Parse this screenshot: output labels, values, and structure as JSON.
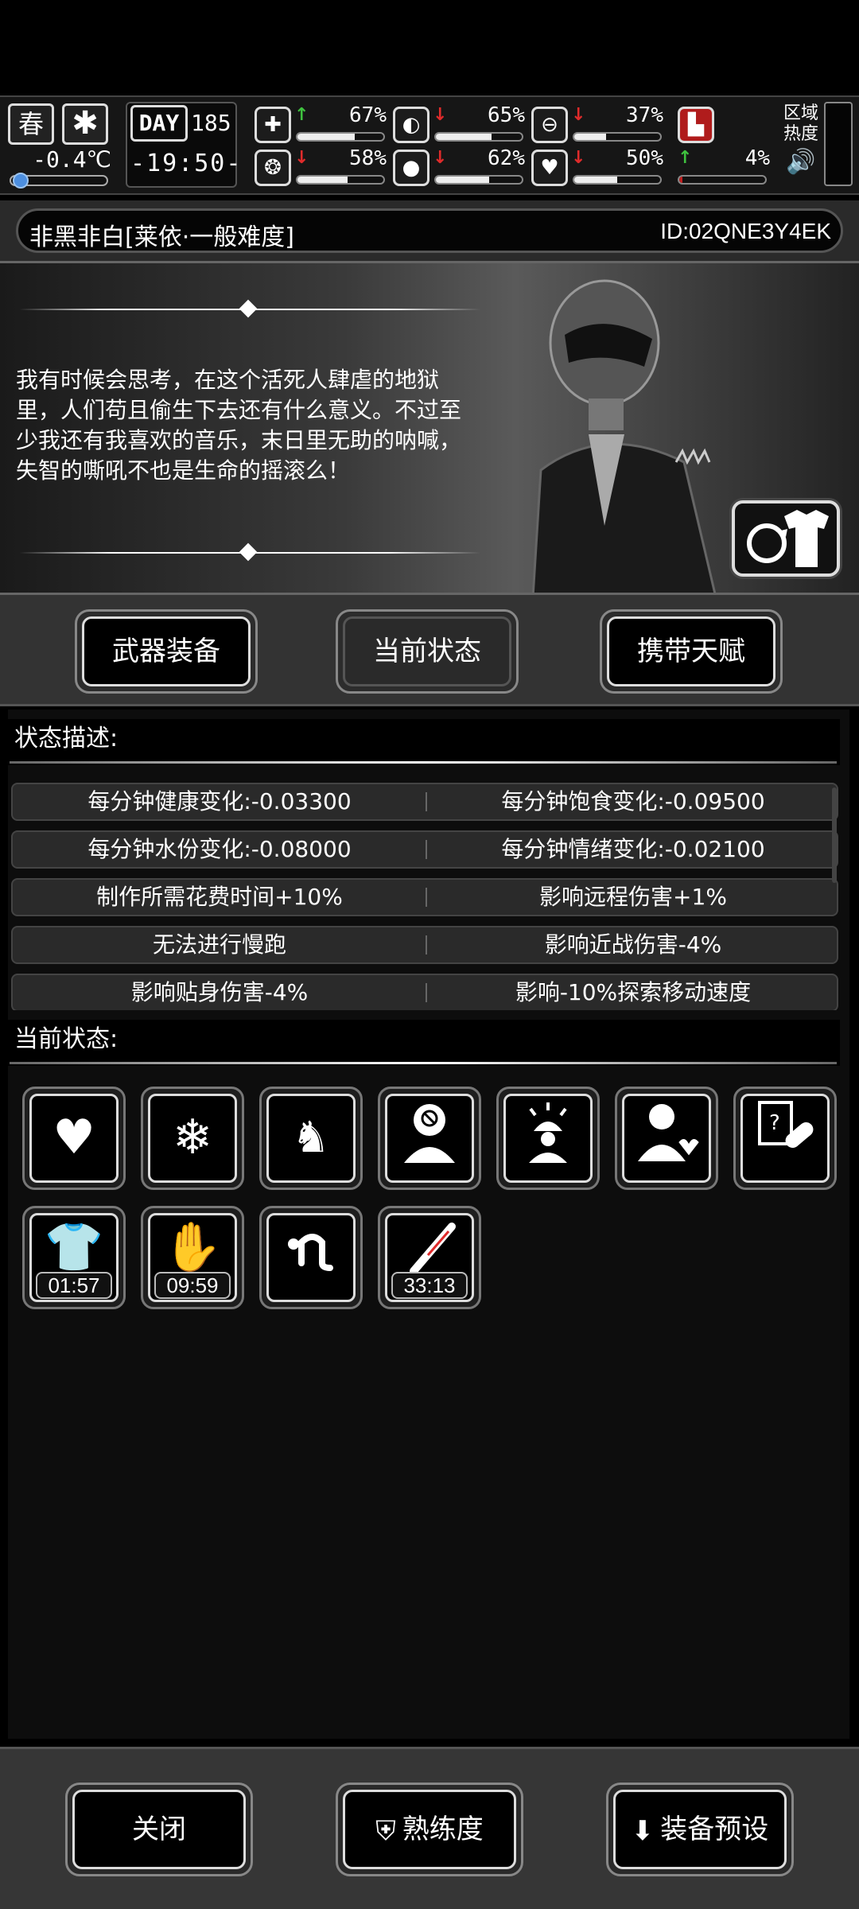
{
  "hud": {
    "season": "春",
    "temperature": "-0.4℃",
    "temperature_level": 0.05,
    "day_label": "DAY",
    "day_number": "185",
    "clock": "-19:50-",
    "stats": [
      {
        "name": "health",
        "icon": "medkit-icon",
        "trend": "up",
        "value": "67%",
        "level": 0.67
      },
      {
        "name": "hunger",
        "icon": "stomach-icon",
        "trend": "down",
        "value": "65%",
        "level": 0.65
      },
      {
        "name": "stamina",
        "icon": "capsule-icon",
        "trend": "down",
        "value": "37%",
        "level": 0.37
      },
      {
        "name": "boots",
        "icon": "boot-icon",
        "trend": "none",
        "value": "",
        "level": 0
      },
      {
        "name": "brain",
        "icon": "brain-icon",
        "trend": "down",
        "value": "58%",
        "level": 0.58
      },
      {
        "name": "water",
        "icon": "water-drop-icon",
        "trend": "down",
        "value": "62%",
        "level": 0.62
      },
      {
        "name": "mood",
        "icon": "heart-icon",
        "trend": "down",
        "value": "50%",
        "level": 0.5
      },
      {
        "name": "infection",
        "icon": "blank-icon",
        "trend": "up",
        "value": "4%",
        "level": 0.04
      }
    ],
    "zone_label": "区域热度"
  },
  "character": {
    "name": "非黑非白[莱依·一般难度]",
    "id": "ID:02QNE3Y4EK",
    "bio": "我有时候会思考，在这个活死人肆虐的地狱里，人们苟且偷生下去还有什么意义。不过至少我还有我喜欢的音乐，末日里无助的呐喊，失智的嘶吼不也是生命的摇滚么！"
  },
  "tabs": {
    "weapons": "武器装备",
    "status": "当前状态",
    "talents": "携带天赋"
  },
  "status_section": {
    "title": "状态描述:",
    "rows": [
      {
        "left": "每分钟健康变化:-0.03300",
        "right": "每分钟饱食变化:-0.09500"
      },
      {
        "left": "每分钟水份变化:-0.08000",
        "right": "每分钟情绪变化:-0.02100"
      },
      {
        "left": "制作所需花费时间+10%",
        "right": "影响远程伤害+1%"
      },
      {
        "left": "无法进行慢跑",
        "right": "影响近战伤害-4%"
      },
      {
        "left": "影响贴身伤害-4%",
        "right": "影响-10%探索移动速度"
      }
    ]
  },
  "current_section": {
    "title": "当前状态:",
    "icons": [
      {
        "name": "heart-icon",
        "timer": ""
      },
      {
        "name": "snowflake-icon",
        "timer": ""
      },
      {
        "name": "horse-mechanic-icon",
        "timer": ""
      },
      {
        "name": "no-thinking-icon",
        "timer": ""
      },
      {
        "name": "alarm-person-icon",
        "timer": ""
      },
      {
        "name": "heartbeat-person-icon",
        "timer": ""
      },
      {
        "name": "medical-report-icon",
        "timer": ""
      },
      {
        "name": "shirt-icon",
        "timer": "01:57"
      },
      {
        "name": "bloody-hand-icon",
        "timer": "09:59"
      },
      {
        "name": "crawl-icon",
        "timer": ""
      },
      {
        "name": "thermometer-icon",
        "timer": "33:13"
      }
    ]
  },
  "footer": {
    "close": "关闭",
    "proficiency": "熟练度",
    "preset": "装备预设"
  }
}
